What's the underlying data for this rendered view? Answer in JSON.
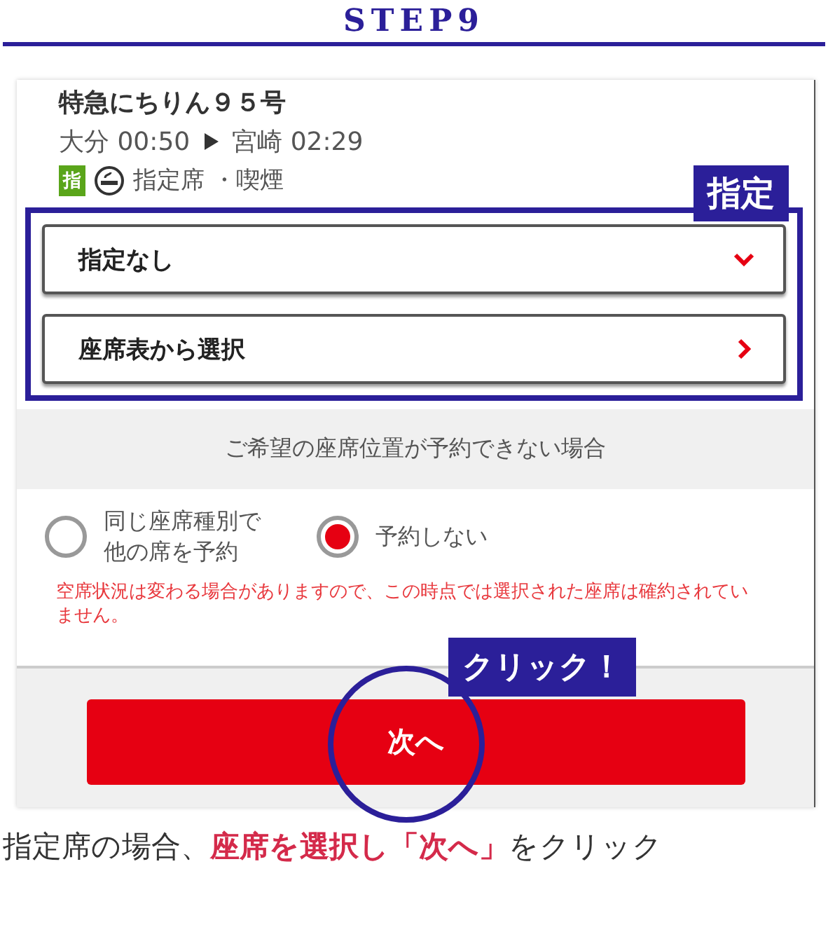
{
  "step_title": "STEP9",
  "train": {
    "name": "特急にちりん９５号",
    "from": "大分 00:50",
    "to": "宮崎 02:29",
    "seat_badge": "指",
    "seat_info": "指定席 ・喫煙"
  },
  "highlight_label": "指定",
  "selects": [
    {
      "label": "指定なし",
      "kind": "dropdown"
    },
    {
      "label": "座席表から選択",
      "kind": "link"
    }
  ],
  "fallback": {
    "title": "ご希望の座席位置が予約できない場合",
    "options": [
      {
        "label_lines": [
          "同じ座席種別で",
          "他の席を予約"
        ],
        "selected": false
      },
      {
        "label_lines": [
          "予約しない"
        ],
        "selected": true
      }
    ],
    "notice": "空席状況は変わる場合がありますので、この時点では選択された座席は確約されていません。"
  },
  "next_button": "次へ",
  "click_label": "クリック！",
  "caption": "指定席の場合、**座席を選択し「次へ」**をクリック"
}
